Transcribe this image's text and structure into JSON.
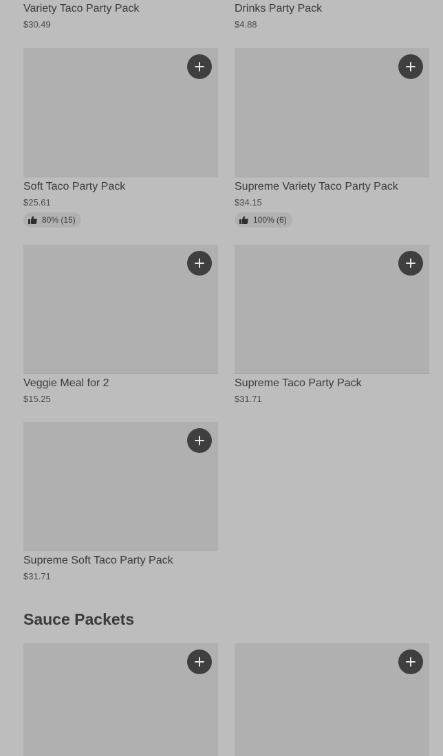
{
  "top_items": [
    {
      "name": "Variety Taco Party Pack",
      "price": "$30.49"
    },
    {
      "name": "Drinks Party Pack",
      "price": "$4.88"
    }
  ],
  "cards": [
    {
      "name": "Soft Taco Party Pack",
      "price": "$25.61",
      "rating": "80% (15)"
    },
    {
      "name": "Supreme Variety Taco Party Pack",
      "price": "$34.15",
      "rating": "100% (6)"
    },
    {
      "name": "Veggie Meal for 2",
      "price": "$15.25"
    },
    {
      "name": "Supreme Taco Party Pack",
      "price": "$31.71"
    },
    {
      "name": "Supreme Soft Taco Party Pack",
      "price": "$31.71"
    }
  ],
  "section": {
    "title": "Sauce Packets"
  },
  "icons": {
    "add": "plus-icon",
    "rating": "thumbs-up-icon"
  },
  "colors": {
    "background": "#bdbdbd",
    "image_placeholder": "#b0b0b0",
    "add_button": "#3f3f3f",
    "text": "#3a3a3a"
  }
}
